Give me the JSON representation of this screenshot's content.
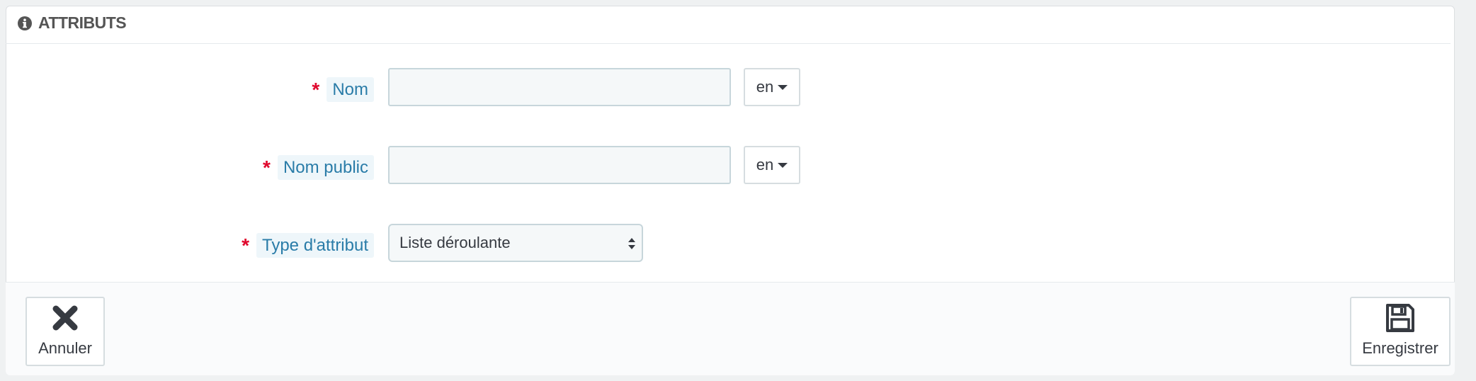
{
  "panel": {
    "title": "ATTRIBUTS",
    "icon": "info-circle-icon"
  },
  "form": {
    "name": {
      "label": "Nom",
      "required_mark": "*",
      "value": "",
      "lang": "en"
    },
    "public_name": {
      "label": "Nom public",
      "required_mark": "*",
      "value": "",
      "lang": "en"
    },
    "attribute_type": {
      "label": "Type d'attribut",
      "required_mark": "*",
      "selected": "Liste déroulante"
    }
  },
  "footer": {
    "cancel_label": "Annuler",
    "cancel_icon": "close-icon",
    "save_label": "Enregistrer",
    "save_icon": "floppy-disk-icon"
  },
  "colors": {
    "accent_label": "#2a7ca8",
    "required": "#e0082d",
    "input_bg": "#f5f8f9"
  }
}
